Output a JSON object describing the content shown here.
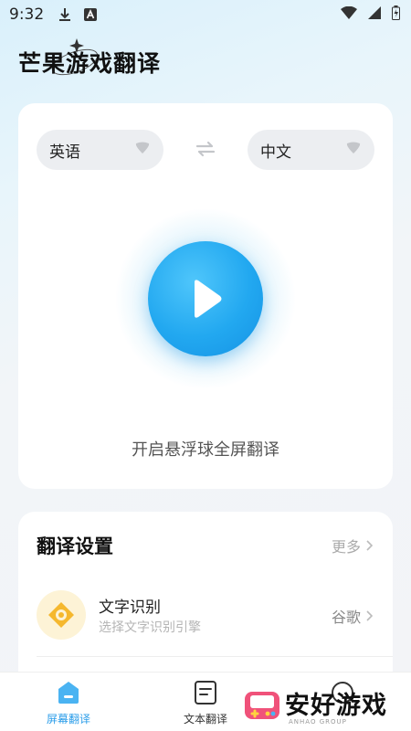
{
  "status_bar": {
    "time": "9:32"
  },
  "app": {
    "title": "芒果游戏翻译"
  },
  "translator": {
    "source_lang": "英语",
    "target_lang": "中文",
    "start_label": "开启悬浮球全屏翻译"
  },
  "settings": {
    "title": "翻译设置",
    "more_label": "更多",
    "ocr": {
      "title": "文字识别",
      "subtitle": "选择文字识别引擎",
      "value": "谷歌"
    }
  },
  "nav": {
    "items": [
      {
        "label": "屏幕翻译",
        "icon": "screen-translate-icon",
        "active": true
      },
      {
        "label": "文本翻译",
        "icon": "text-translate-icon",
        "active": false
      }
    ]
  },
  "watermark": {
    "text": "安好游戏",
    "sub": "ANHAO GROUP"
  },
  "colors": {
    "accent": "#2b9de9",
    "play_blue": "#22a8f0",
    "ocr_yellow": "#f5b82e"
  }
}
